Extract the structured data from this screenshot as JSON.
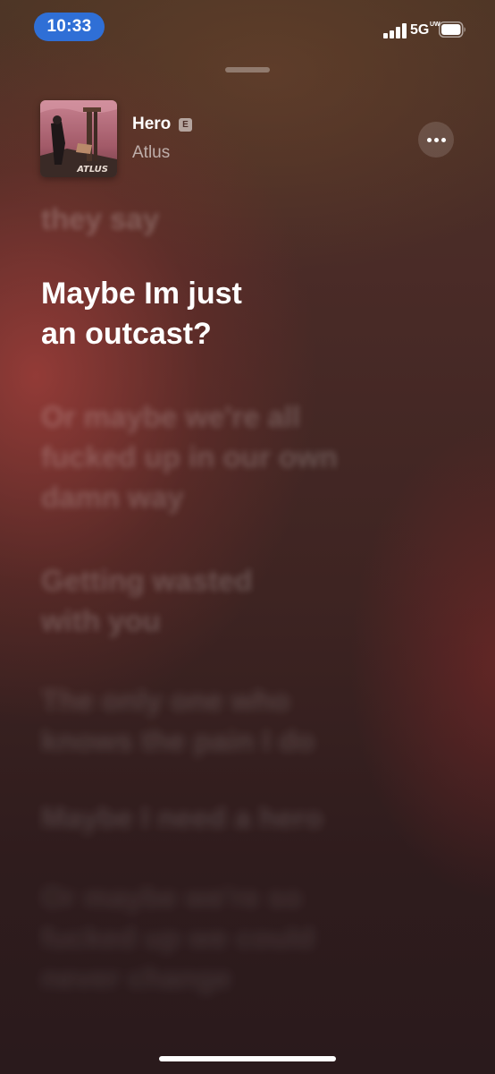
{
  "status_bar": {
    "time": "10:33",
    "network": "5G",
    "network_badge": "UW",
    "signal_icon": "signal-bars-icon",
    "battery_icon": "battery-icon",
    "accent_color": "#2f6fd6"
  },
  "now_playing": {
    "title": "Hero",
    "explicit": "E",
    "artist": "Atlus",
    "artwork_label": "ATLUS",
    "more_icon": "ellipsis-icon"
  },
  "lyrics": {
    "previous": "they say",
    "current": "Maybe Im just\nan outcast?",
    "upcoming": [
      "Or maybe we're all\nfucked up in our own\ndamn way",
      "Getting wasted\nwith you",
      "The only one who\nknows the pain I do",
      "Maybe I need a hero",
      "Or maybe we're so\nfucked up we could\nnever change"
    ]
  }
}
